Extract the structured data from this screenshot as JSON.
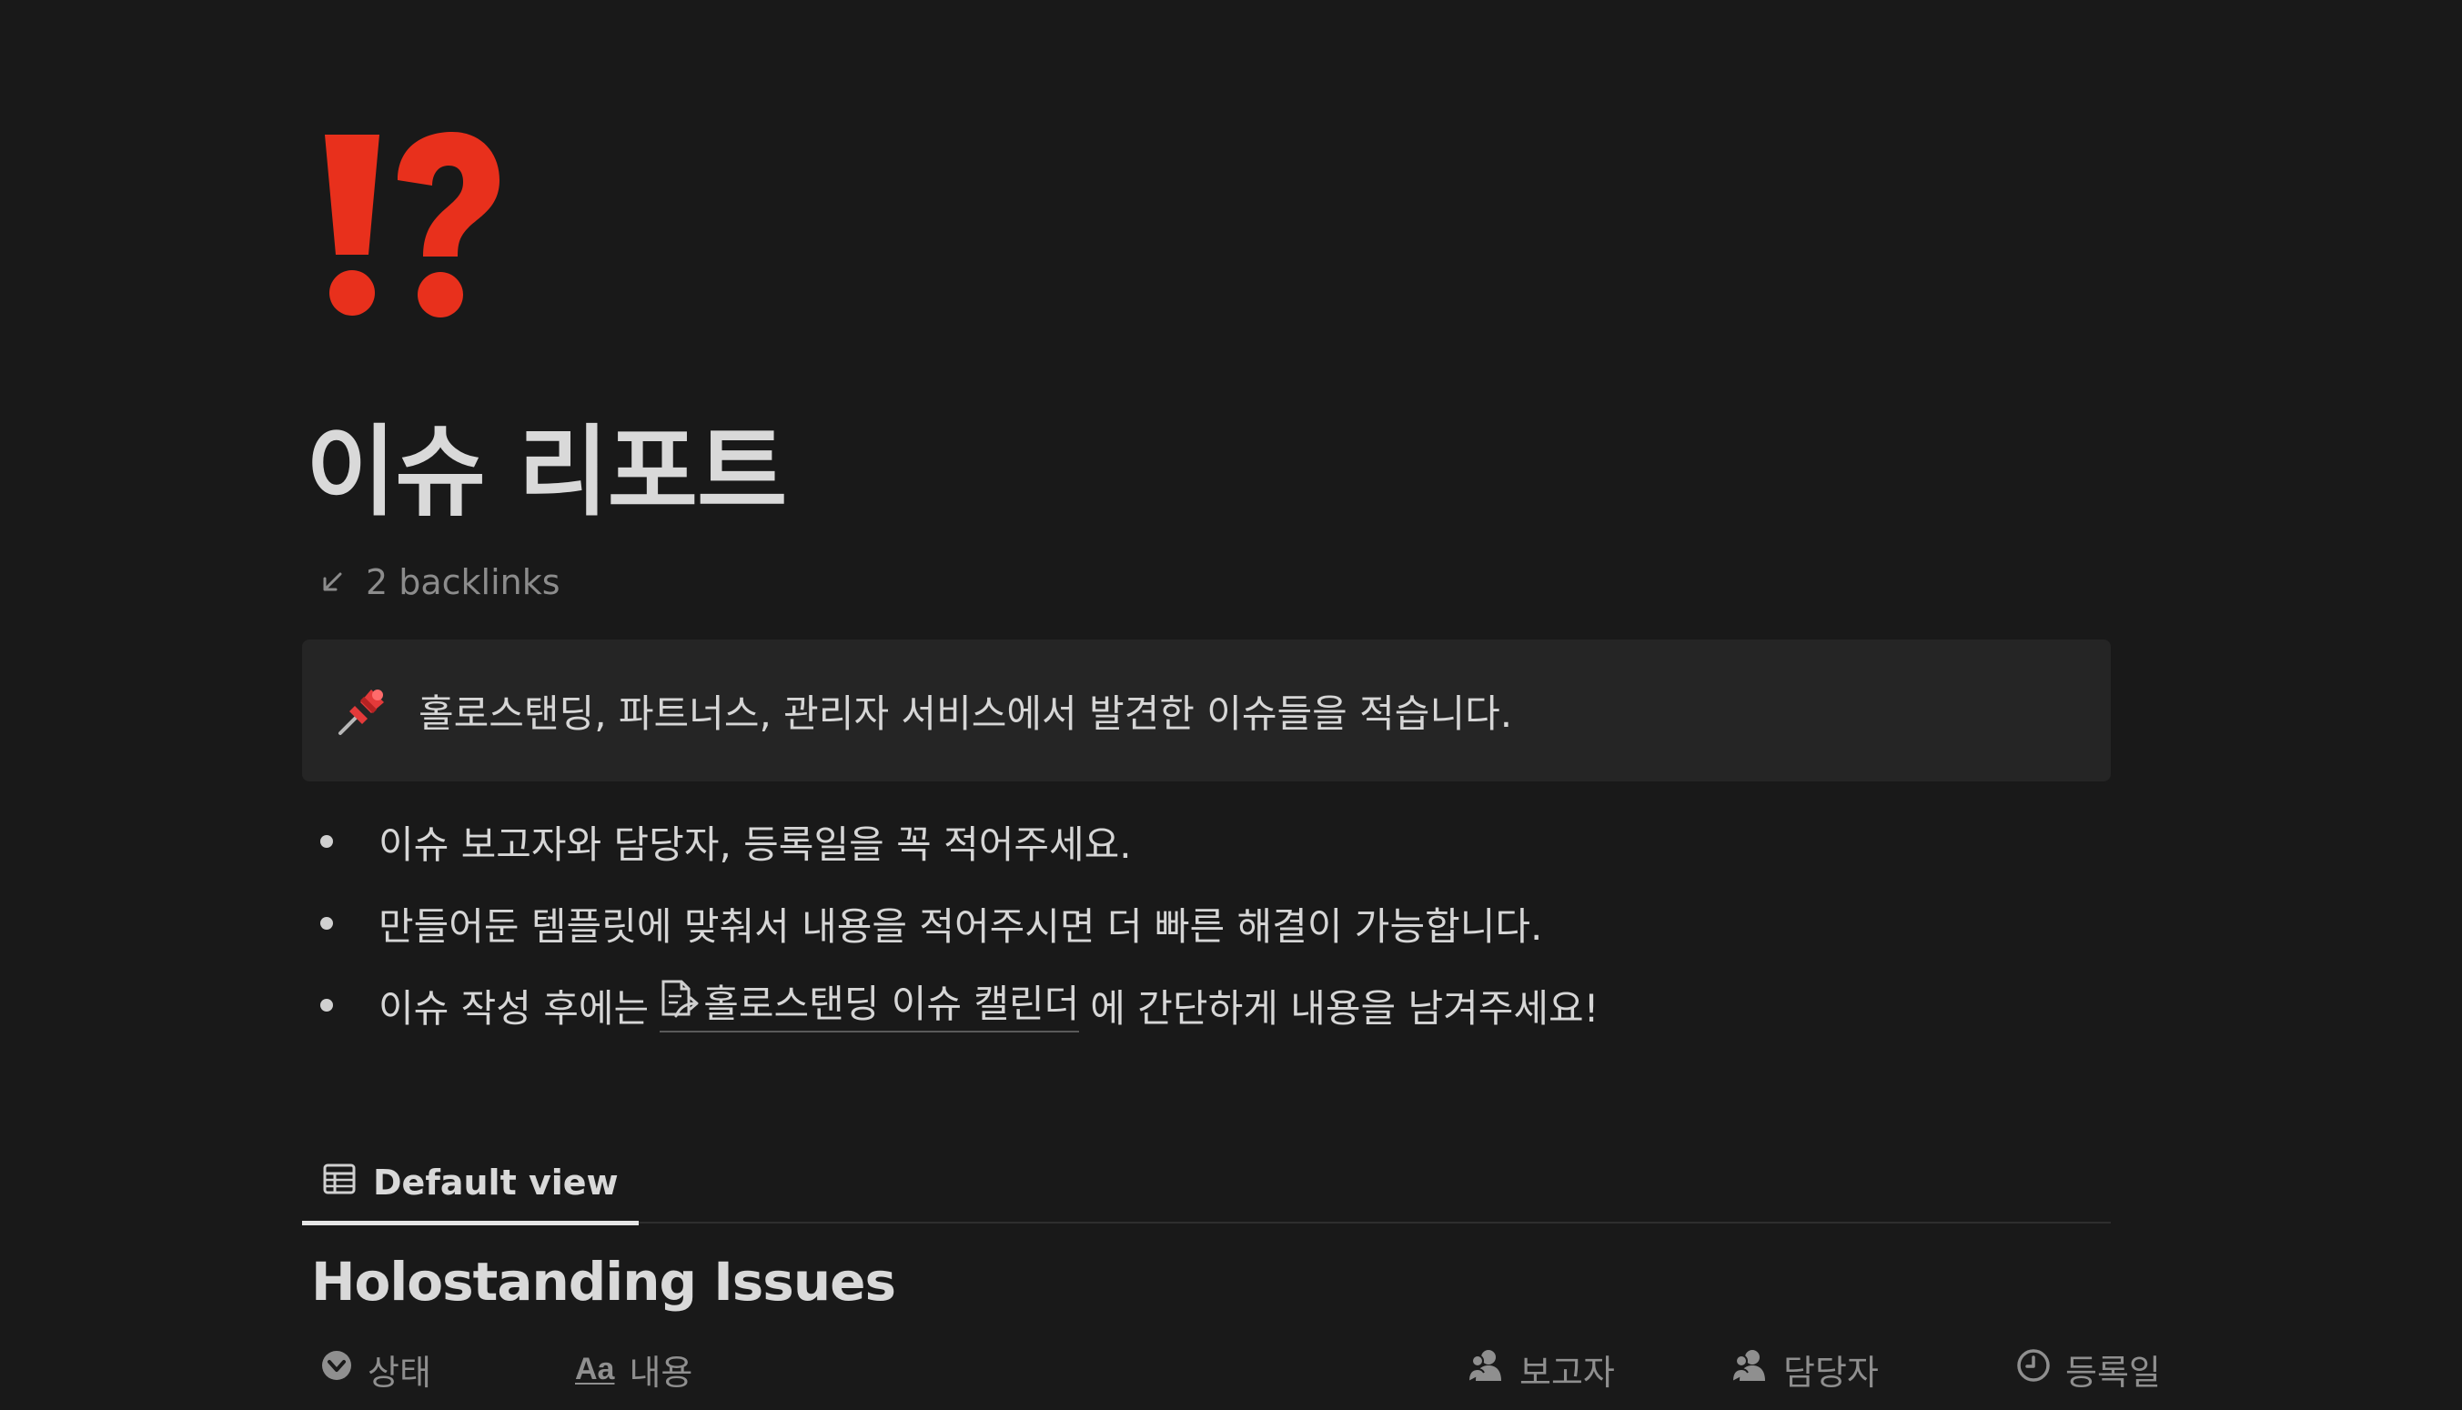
{
  "page": {
    "icon": "exclamation-question-mark-icon",
    "title": "이슈 리포트",
    "backlinks_label": "2 backlinks"
  },
  "callout": {
    "icon": "pushpin-icon",
    "text": "홀로스탠딩, 파트너스, 관리자 서비스에서 발견한 이슈들을 적습니다."
  },
  "bullets": [
    {
      "text": "이슈 보고자와 담당자, 등록일을 꼭 적어주세요."
    },
    {
      "text": "만들어둔 템플릿에 맞춰서 내용을 적어주시면 더 빠른 해결이 가능합니다."
    },
    {
      "text_before": "이슈 작성 후에는",
      "link_icon": "page-link-icon",
      "link_text": "홀로스탠딩 이슈 캘린더",
      "text_after": "에 간단하게 내용을 남겨주세요!"
    }
  ],
  "views": {
    "active_tab_label": "Default view",
    "active_tab_icon": "table-icon"
  },
  "database": {
    "title": "Holostanding Issues",
    "columns": [
      {
        "label": "상태",
        "icon": "status-icon"
      },
      {
        "label": "내용",
        "icon": "title-aa-icon"
      },
      {
        "label": "보고자",
        "icon": "person-icon"
      },
      {
        "label": "담당자",
        "icon": "person-icon"
      },
      {
        "label": "등록일",
        "icon": "clock-icon"
      }
    ]
  },
  "colors": {
    "background": "#191919",
    "callout_bg": "#252525",
    "icon_red": "#e8301c"
  }
}
